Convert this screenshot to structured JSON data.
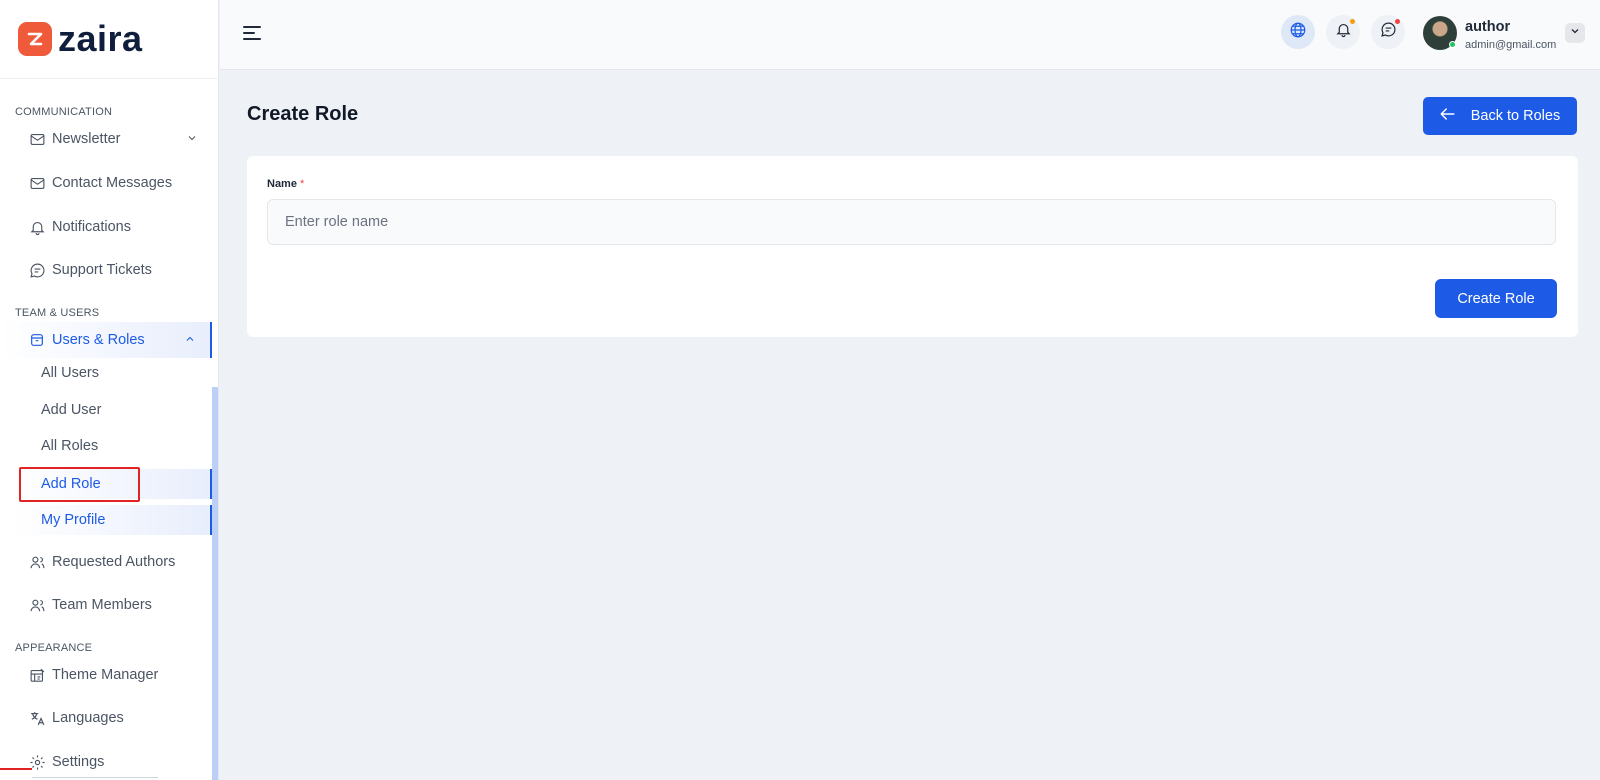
{
  "brand": {
    "name": "zaira"
  },
  "sidebar": {
    "sections": {
      "communication": "COMMUNICATION",
      "team_users": "TEAM & USERS",
      "appearance": "APPEARANCE"
    },
    "items": {
      "newsletter": "Newsletter",
      "contact_messages": "Contact Messages",
      "notifications": "Notifications",
      "support_tickets": "Support Tickets",
      "users_roles": "Users & Roles",
      "requested_authors": "Requested Authors",
      "team_members": "Team Members",
      "theme_manager": "Theme Manager",
      "languages": "Languages",
      "settings": "Settings"
    },
    "sub_items": {
      "all_users": "All Users",
      "add_user": "Add User",
      "all_roles": "All Roles",
      "add_role": "Add Role",
      "my_profile": "My Profile"
    }
  },
  "header": {
    "user_name": "author",
    "user_email": "admin@gmail.com",
    "icons": [
      "menu-icon",
      "globe-icon",
      "bell-icon",
      "chat-icon",
      "chevron-down-icon"
    ]
  },
  "main": {
    "title": "Create Role",
    "back_button": "Back to Roles",
    "form": {
      "name_label": "Name",
      "required_mark": "*",
      "name_placeholder": "Enter role name",
      "name_value": "",
      "submit_button": "Create Role"
    }
  },
  "colors": {
    "accent": "#1d5be6",
    "brand_logo": "#ef5b3a",
    "background": "#eef1f5",
    "highlight": "#e02424"
  }
}
